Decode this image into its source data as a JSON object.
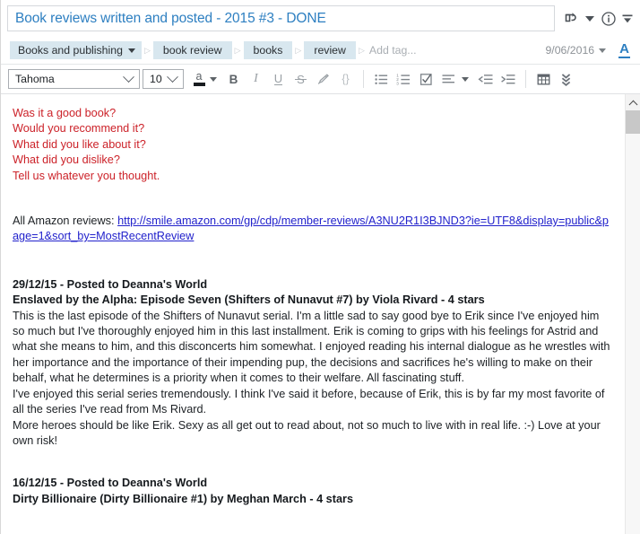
{
  "window": {
    "title": "Book reviews written and posted - 2015 #3 - DONE"
  },
  "title_bar": {
    "icons": [
      {
        "name": "share-note-icon",
        "label": "Share"
      },
      {
        "name": "share-dropdown-caret",
        "label": "Share options"
      },
      {
        "name": "note-info-icon",
        "label": "Note info"
      },
      {
        "name": "more-options-caret",
        "label": "More"
      }
    ]
  },
  "tags": {
    "notebook": "Books and publishing",
    "items": [
      "book review",
      "books",
      "review"
    ],
    "add_placeholder": "Add tag...",
    "date": "9/06/2016",
    "format_letter": "A"
  },
  "format_toolbar": {
    "font_family": "Tahoma",
    "font_size": "10",
    "text_color_letter": "a",
    "bold": "B",
    "italic": "I",
    "underline": "U",
    "strikethrough": "S",
    "highlight": "highlight",
    "code": "{}",
    "bullet_list": "bullet-list",
    "numbered_list": "numbered-list",
    "checkbox_list": "checkbox-list",
    "align": "align",
    "outdent": "outdent",
    "indent": "indent",
    "table": "table",
    "more": "more-formatting"
  },
  "note": {
    "prompts": [
      "Was it a good book?",
      "Would you recommend it?",
      "What did you like about it?",
      "What did you dislike?",
      "Tell us whatever you thought."
    ],
    "amazon_label": "All Amazon reviews: ",
    "amazon_url": "http://smile.amazon.com/gp/cdp/member-reviews/A3NU2R1I3BJND3?ie=UTF8&display=public&page=1&sort_by=MostRecentReview",
    "reviews": [
      {
        "date": "29/12/15 - Posted to Deanna's World",
        "title": "Enslaved by the Alpha: Episode Seven (Shifters of Nunavut #7) by Viola Rivard - 4 stars",
        "paragraphs": [
          "This is the last episode of the Shifters of Nunavut serial. I'm a little sad to say good bye to Erik since I've enjoyed him so much but I've thoroughly enjoyed him in this last installment. Erik is coming to grips with his feelings for Astrid and what she means to him, and this disconcerts him somewhat. I enjoyed reading his internal dialogue as he wrestles with her importance and the importance of their impending pup, the decisions and sacrifices he's willing to make on their behalf, what he determines is a priority when it comes to their welfare. All fascinating stuff.",
          "I've enjoyed this serial series tremendously. I think I've said it before, because of Erik, this is by far my most favorite of all the series I've read from Ms Rivard.",
          "More heroes should be like Erik. Sexy as all get out to read about, not so much to live with in real life. :-) Love at your own risk!"
        ]
      },
      {
        "date": "16/12/15 - Posted to Deanna's World",
        "title": "Dirty Billionaire (Dirty Billionaire #1) by Meghan March - 4 stars",
        "paragraphs": []
      }
    ]
  },
  "scrollbar": {
    "up_arrow": "scroll-up-arrow"
  },
  "colors": {
    "title_blue": "#2d7fc1",
    "tag_chip": "#d8e7ef",
    "prompt_red": "#cc2229",
    "link_blue": "#2222cc"
  }
}
